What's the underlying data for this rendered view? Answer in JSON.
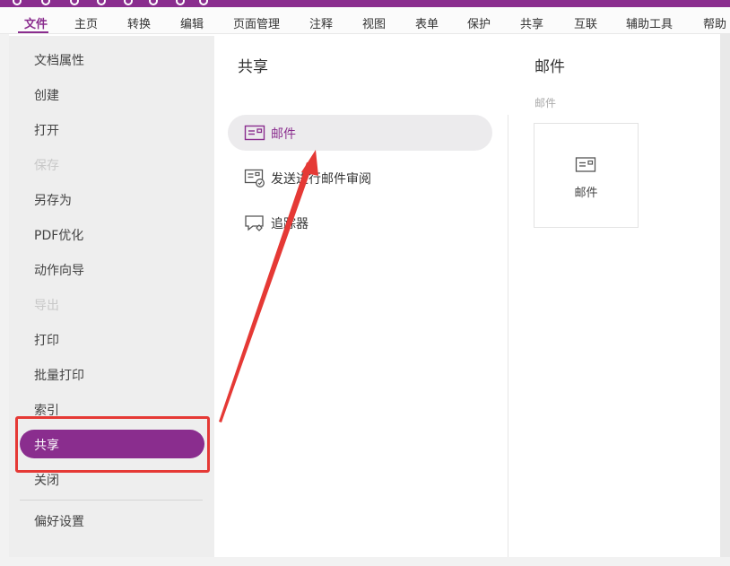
{
  "menu": {
    "items": [
      "文件",
      "主页",
      "转换",
      "编辑",
      "页面管理",
      "注释",
      "视图",
      "表单",
      "保护",
      "共享",
      "互联",
      "辅助工具",
      "帮助"
    ],
    "active_index": 0
  },
  "leftnav": {
    "items": [
      {
        "label": "文档属性",
        "disabled": false
      },
      {
        "label": "创建",
        "disabled": false
      },
      {
        "label": "打开",
        "disabled": false
      },
      {
        "label": "保存",
        "disabled": true
      },
      {
        "label": "另存为",
        "disabled": false
      },
      {
        "label": "PDF优化",
        "disabled": false
      },
      {
        "label": "动作向导",
        "disabled": false
      },
      {
        "label": "导出",
        "disabled": true
      },
      {
        "label": "打印",
        "disabled": false
      },
      {
        "label": "批量打印",
        "disabled": false
      },
      {
        "label": "索引",
        "disabled": false
      },
      {
        "label": "共享",
        "disabled": false,
        "active": true
      },
      {
        "label": "关闭",
        "disabled": false
      },
      {
        "label": "偏好设置",
        "disabled": false
      }
    ]
  },
  "middle": {
    "title": "共享",
    "options": [
      {
        "label": "邮件",
        "icon": "mail-icon",
        "selected": true
      },
      {
        "label": "发送进行邮件审阅",
        "icon": "mail-review-icon",
        "selected": false
      },
      {
        "label": "追踪器",
        "icon": "tracker-icon",
        "selected": false
      }
    ]
  },
  "right": {
    "title": "邮件",
    "subtitle": "邮件",
    "card_label": "邮件"
  },
  "colors": {
    "accent": "#8a2d8e",
    "annotation": "#e53935"
  }
}
